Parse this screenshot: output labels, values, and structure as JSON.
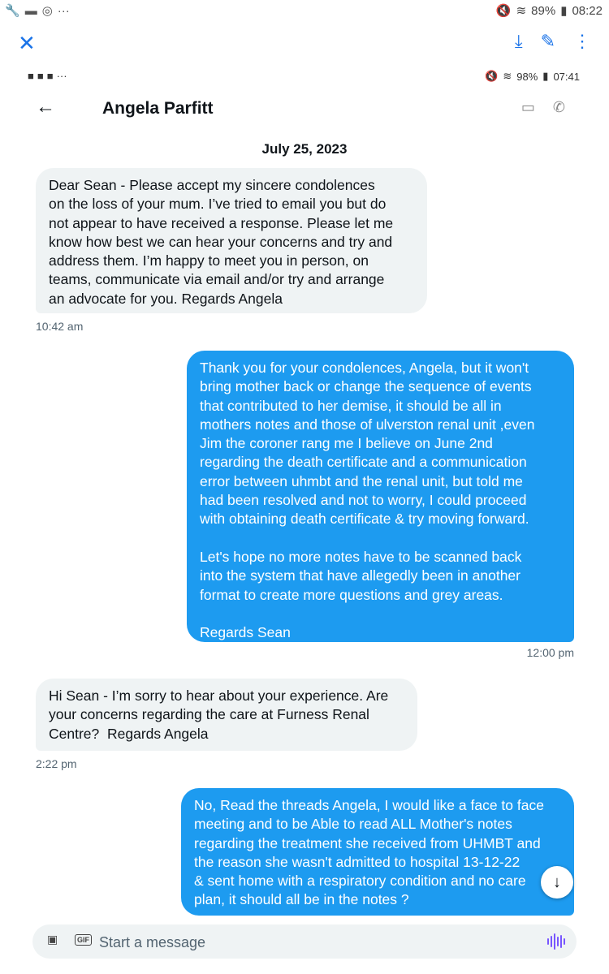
{
  "outer_status": {
    "battery": "89%",
    "time": "08:22"
  },
  "inner_status": {
    "battery": "98%",
    "time": "07:41"
  },
  "header": {
    "name": "Angela Parfitt"
  },
  "date": "July 25, 2023",
  "messages": [
    {
      "dir": "in",
      "text": "Dear Sean - Please accept my sincere condolences\non the loss of your mum. I’ve tried to email you but do\nnot appear to have received a response. Please let me\nknow how best we can hear your concerns and try and\naddress them. I’m happy to meet you in person, on\nteams, communicate via email and/or try and arrange\nan advocate for you. Regards Angela",
      "time": "10:42 am"
    },
    {
      "dir": "out",
      "text": "Thank you for your condolences, Angela, but it won't\nbring mother back or change the sequence of events\nthat contributed to her demise, it should be all in\nmothers notes and those of ulverston renal unit ,even\nJim the coroner rang me I believe on June 2nd\nregarding the death certificate and a communication\nerror between uhmbt and the renal unit, but told me\nhad been resolved and not to worry, I could proceed\nwith obtaining death certificate & try moving forward.\n\nLet's hope no more notes have to be scanned back\ninto the system that have allegedly been in another\nformat to create more questions and grey areas.\n\nRegards Sean",
      "time": "12:00 pm"
    },
    {
      "dir": "in",
      "text": "Hi Sean - I’m sorry to hear about your experience. Are\nyour concerns regarding the care at Furness Renal\nCentre?  Regards Angela",
      "time": "2:22 pm"
    },
    {
      "dir": "out",
      "text": "No, Read the threads Angela, I would like a face to face\nmeeting and to be Able to read ALL Mother's notes\nregarding the treatment she received from UHMBT and\nthe reason she wasn't admitted to hospital 13-12-22\n& sent home with a respiratory condition and no care\nplan, it should all be in the notes ?",
      "time": ""
    }
  ],
  "composer": {
    "placeholder": "Start a message"
  }
}
